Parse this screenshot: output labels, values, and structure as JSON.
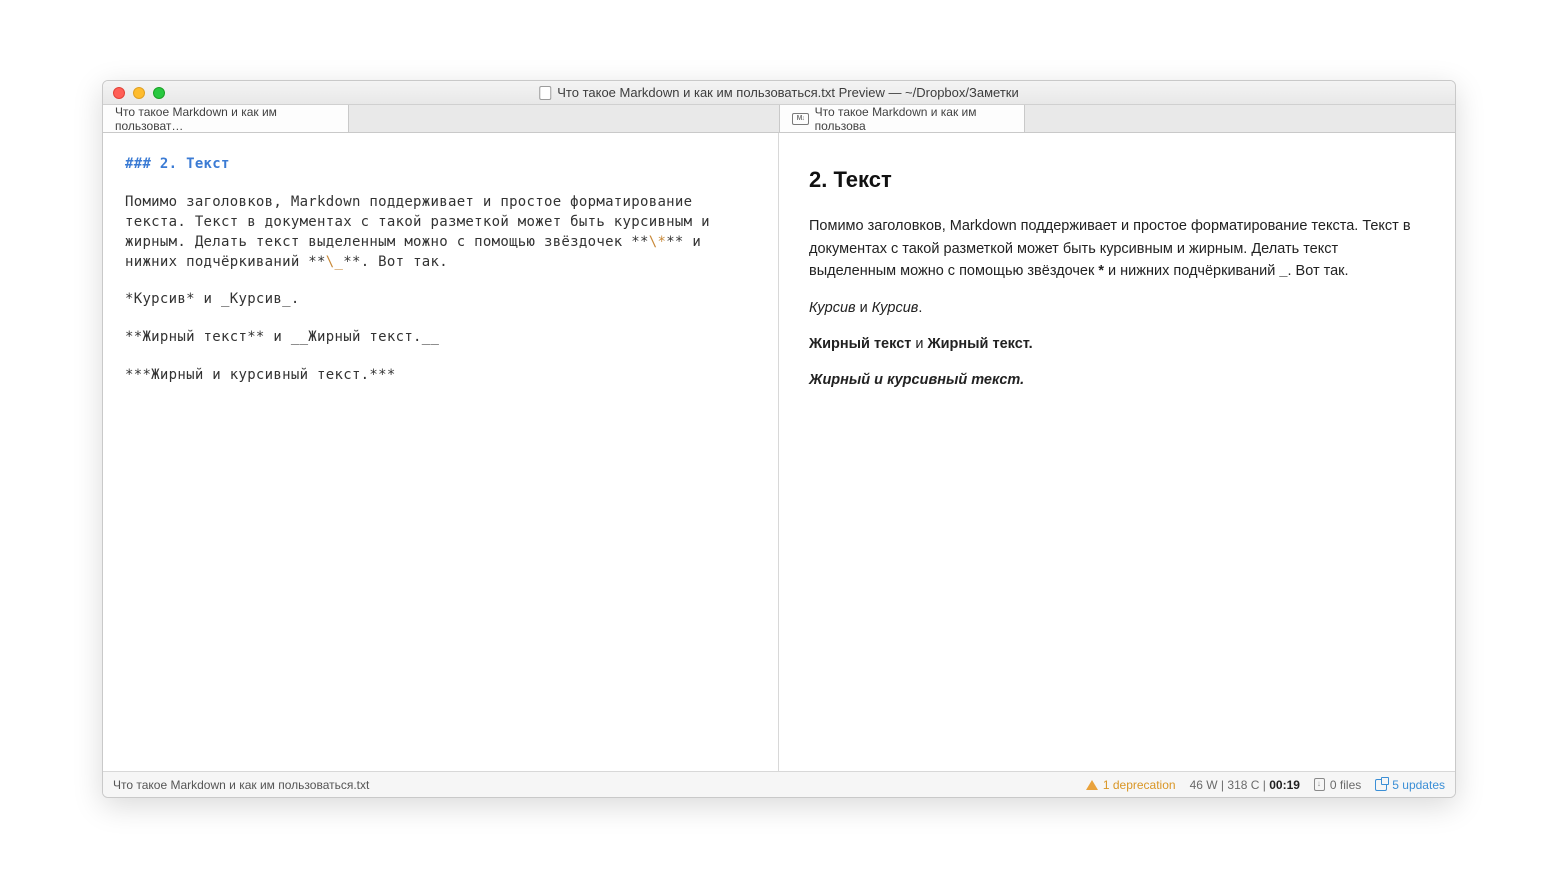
{
  "window": {
    "title": "Что такое Markdown и как им пользоваться.txt Preview — ~/Dropbox/Заметки"
  },
  "tabs": {
    "left": "Что такое Markdown и как им пользоват…",
    "right": "Что такое Markdown и как им пользова"
  },
  "editor": {
    "heading": "### 2. Текст",
    "para1a": "Помимо заголовков, Markdown поддерживает и простое форматирование текста. Текст в документах с такой разметкой может быть курсивным и жирным. Делать текст выделенным можно с помощью звёздочек **",
    "esc1": "\\*",
    "para1b": "** и нижних подчёркиваний **",
    "esc2": "\\_",
    "para1c": "**. Вот так.",
    "line2": "*Курсив* и _Курсив_.",
    "line3": "**Жирный текст** и __Жирный текст.__",
    "line4": "***Жирный и курсивный текст.***"
  },
  "preview": {
    "heading": "2. Текст",
    "p1a": "Помимо заголовков, Markdown поддерживает и простое форматирование текста. Текст в документах с такой разметкой может быть курсивным и жирным. Делать текст выделенным можно с помощью звёздочек ",
    "p1_star": "*",
    "p1b": " и нижних подчёркиваний ",
    "p1_us": "_",
    "p1c": ". Вот так.",
    "p2_italic1": "Курсив",
    "p2_and": " и ",
    "p2_italic2": "Курсив",
    "p2_end": ".",
    "p3_bold1": "Жирный текст",
    "p3_and": " и ",
    "p3_bold2": "Жирный текст.",
    "p4": "Жирный и курсивный текст."
  },
  "status": {
    "filename": "Что такое Markdown и как им пользоваться.txt",
    "deprecation": "1 deprecation",
    "words": "46 W",
    "chars": "318 C",
    "time": "00:19",
    "files": "0 files",
    "updates": "5 updates"
  }
}
